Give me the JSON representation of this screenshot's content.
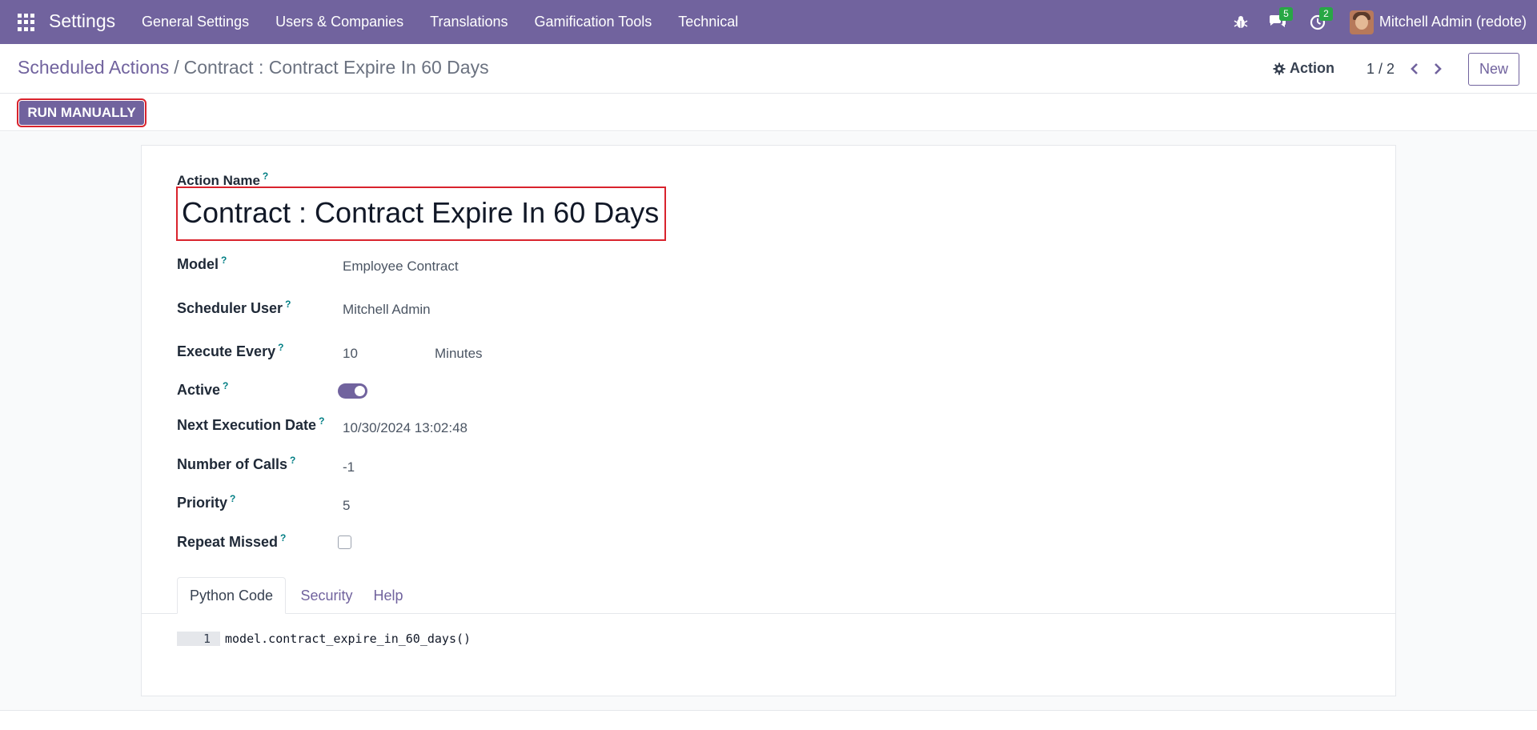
{
  "navbar": {
    "brand": "Settings",
    "menu": [
      "General Settings",
      "Users & Companies",
      "Translations",
      "Gamification Tools",
      "Technical"
    ],
    "chat_badge": "5",
    "activity_badge": "2",
    "user_name": "Mitchell Admin (redote)"
  },
  "control": {
    "breadcrumb_parent": "Scheduled Actions",
    "breadcrumb_separator": "/",
    "breadcrumb_current": "Contract : Contract Expire In 60 Days",
    "action_label": "Action",
    "pager": "1 / 2",
    "new_label": "New"
  },
  "statusbar": {
    "run_label": "RUN MANUALLY"
  },
  "form": {
    "name_label": "Action Name",
    "name_value": "Contract : Contract Expire In 60 Days",
    "tip_mark": "?",
    "fields": {
      "model": {
        "label": "Model",
        "value": "Employee Contract"
      },
      "user": {
        "label": "Scheduler User",
        "value": "Mitchell Admin"
      },
      "interval": {
        "label": "Execute Every",
        "value": "10",
        "unit": "Minutes"
      },
      "active": {
        "label": "Active",
        "value": true
      },
      "nextcall": {
        "label": "Next Execution Date",
        "value": "10/30/2024 13:02:48"
      },
      "numbercall": {
        "label": "Number of Calls",
        "value": "-1"
      },
      "priority": {
        "label": "Priority",
        "value": "5"
      },
      "doall": {
        "label": "Repeat Missed",
        "value": false
      }
    },
    "tabs": [
      "Python Code",
      "Security",
      "Help"
    ],
    "active_tab": "Python Code",
    "code": {
      "line_number": "1",
      "text": "model.contract_expire_in_60_days()"
    }
  },
  "colors": {
    "brand": "#71639e",
    "highlight": "#d9232d",
    "badge": "#28a745",
    "tooltip": "#017e84"
  }
}
